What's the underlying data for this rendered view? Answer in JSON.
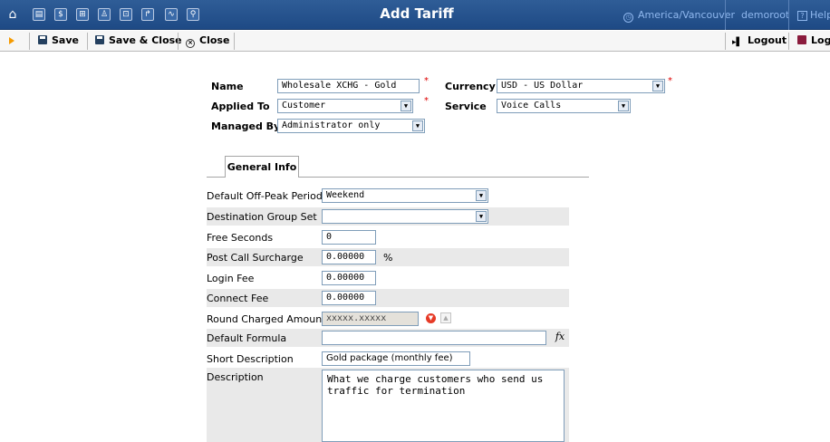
{
  "topbar": {
    "title": "Add Tariff",
    "timezone": "America/Vancouver",
    "user": "demoroot",
    "help": "Help",
    "icons": [
      "home-icon",
      "list-icon",
      "dollar-icon",
      "grid-icon",
      "person-icon",
      "network-icon",
      "flow-icon",
      "chart-icon",
      "search-icon"
    ],
    "icon_glyphs": [
      "⌂",
      "▤",
      "$",
      "⊞",
      "♙",
      "⊡",
      "↱",
      "∿",
      "⚲"
    ]
  },
  "toolbar": {
    "save_label": "Save",
    "save_close_label": "Save & Close",
    "close_label": "Close",
    "logout_label": "Logout",
    "logs_label": "Logs"
  },
  "form": {
    "name_label": "Name",
    "name_value": "Wholesale XCHG - Gold",
    "currency_label": "Currency",
    "currency_value": "USD - US Dollar",
    "applied_to_label": "Applied To",
    "applied_to_value": "Customer",
    "service_label": "Service",
    "service_value": "Voice Calls",
    "managed_by_label": "Managed By",
    "managed_by_value": "Administrator only",
    "required_mark": "*"
  },
  "tabs": [
    {
      "label": "General Info",
      "active": true
    }
  ],
  "general_info": {
    "default_off_peak_label": "Default Off-Peak Period",
    "default_off_peak_value": "Weekend",
    "destination_group_set_label": "Destination Group Set",
    "destination_group_set_value": "",
    "free_seconds_label": "Free Seconds",
    "free_seconds_value": "0",
    "post_call_surcharge_label": "Post Call Surcharge",
    "post_call_surcharge_value": "0.00000",
    "post_call_surcharge_unit": "%",
    "login_fee_label": "Login Fee",
    "login_fee_value": "0.00000",
    "connect_fee_label": "Connect Fee",
    "connect_fee_value": "0.00000",
    "round_charged_amount_label": "Round Charged Amount",
    "round_charged_amount_value": "xxxxx.xxxxx",
    "default_formula_label": "Default Formula",
    "default_formula_value": "",
    "short_description_label": "Short Description",
    "short_description_value": "Gold package (monthly fee)",
    "description_label": "Description",
    "description_value": "What we charge customers who send us traffic for termination"
  },
  "colors": {
    "topbar": "#1e4a85",
    "accent_orange": "#f59a00",
    "row_shade": "#e9e9e9",
    "required": "#dd0000"
  }
}
